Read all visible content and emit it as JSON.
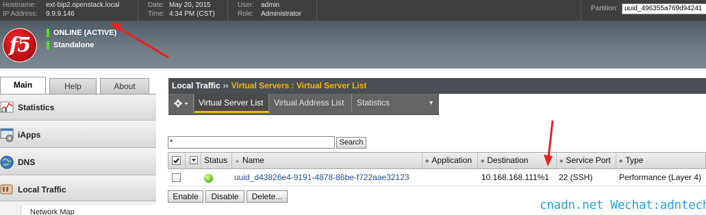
{
  "topbar": {
    "hostname_label": "Hostname:",
    "hostname": "ext-bip2.openstack.local",
    "ip_label": "IP Address:",
    "ip": "9.9.9.146",
    "date_label": "Date:",
    "date": "May 20, 2015",
    "time_label": "Time:",
    "time": "4:34 PM (CST)",
    "user_label": "User:",
    "user": "admin",
    "role_label": "Role:",
    "role": "Administrator",
    "partition_label": "Partition:",
    "partition_value": "uuid_496355a769d94241"
  },
  "banner": {
    "logo_text": "f5",
    "status_primary": "ONLINE (ACTIVE)",
    "status_secondary": "Standalone",
    "status_color": "#5fd43a"
  },
  "left_tabs": [
    "Main",
    "Help",
    "About"
  ],
  "left_nav": {
    "items": [
      {
        "label": "Statistics",
        "icon": "statistics-icon"
      },
      {
        "label": "iApps",
        "icon": "iapps-icon"
      },
      {
        "label": "DNS",
        "icon": "dns-globe-icon"
      },
      {
        "label": "Local Traffic",
        "icon": "local-traffic-icon"
      }
    ],
    "sub_item": "Network Map"
  },
  "breadcrumb": {
    "section": "Local Traffic",
    "separator": "››",
    "current": "Virtual Servers : Virtual Server List"
  },
  "subnav": {
    "gear_icon": "gear-icon",
    "tabs": [
      "Virtual Server List",
      "Virtual Address List",
      "Statistics"
    ],
    "active_tab": "Virtual Server List",
    "accent_color": "#f2b600"
  },
  "search": {
    "value": "*",
    "button_label": "Search"
  },
  "table": {
    "columns": [
      "Status",
      "Name",
      "Application",
      "Destination",
      "Service Port",
      "Type"
    ],
    "rows": [
      {
        "status": "available",
        "name": "uuid_d43826e4-9191-4878-86be-f722aae32123",
        "application": "",
        "destination": "10.168.168.111%1",
        "service_port": "22 (SSH)",
        "type": "Performance (Layer 4)"
      }
    ]
  },
  "actions": [
    "Enable",
    "Disable",
    "Delete..."
  ],
  "watermark": "cnadn.net Wechat:adntech",
  "annotation_color": "#e8231d"
}
